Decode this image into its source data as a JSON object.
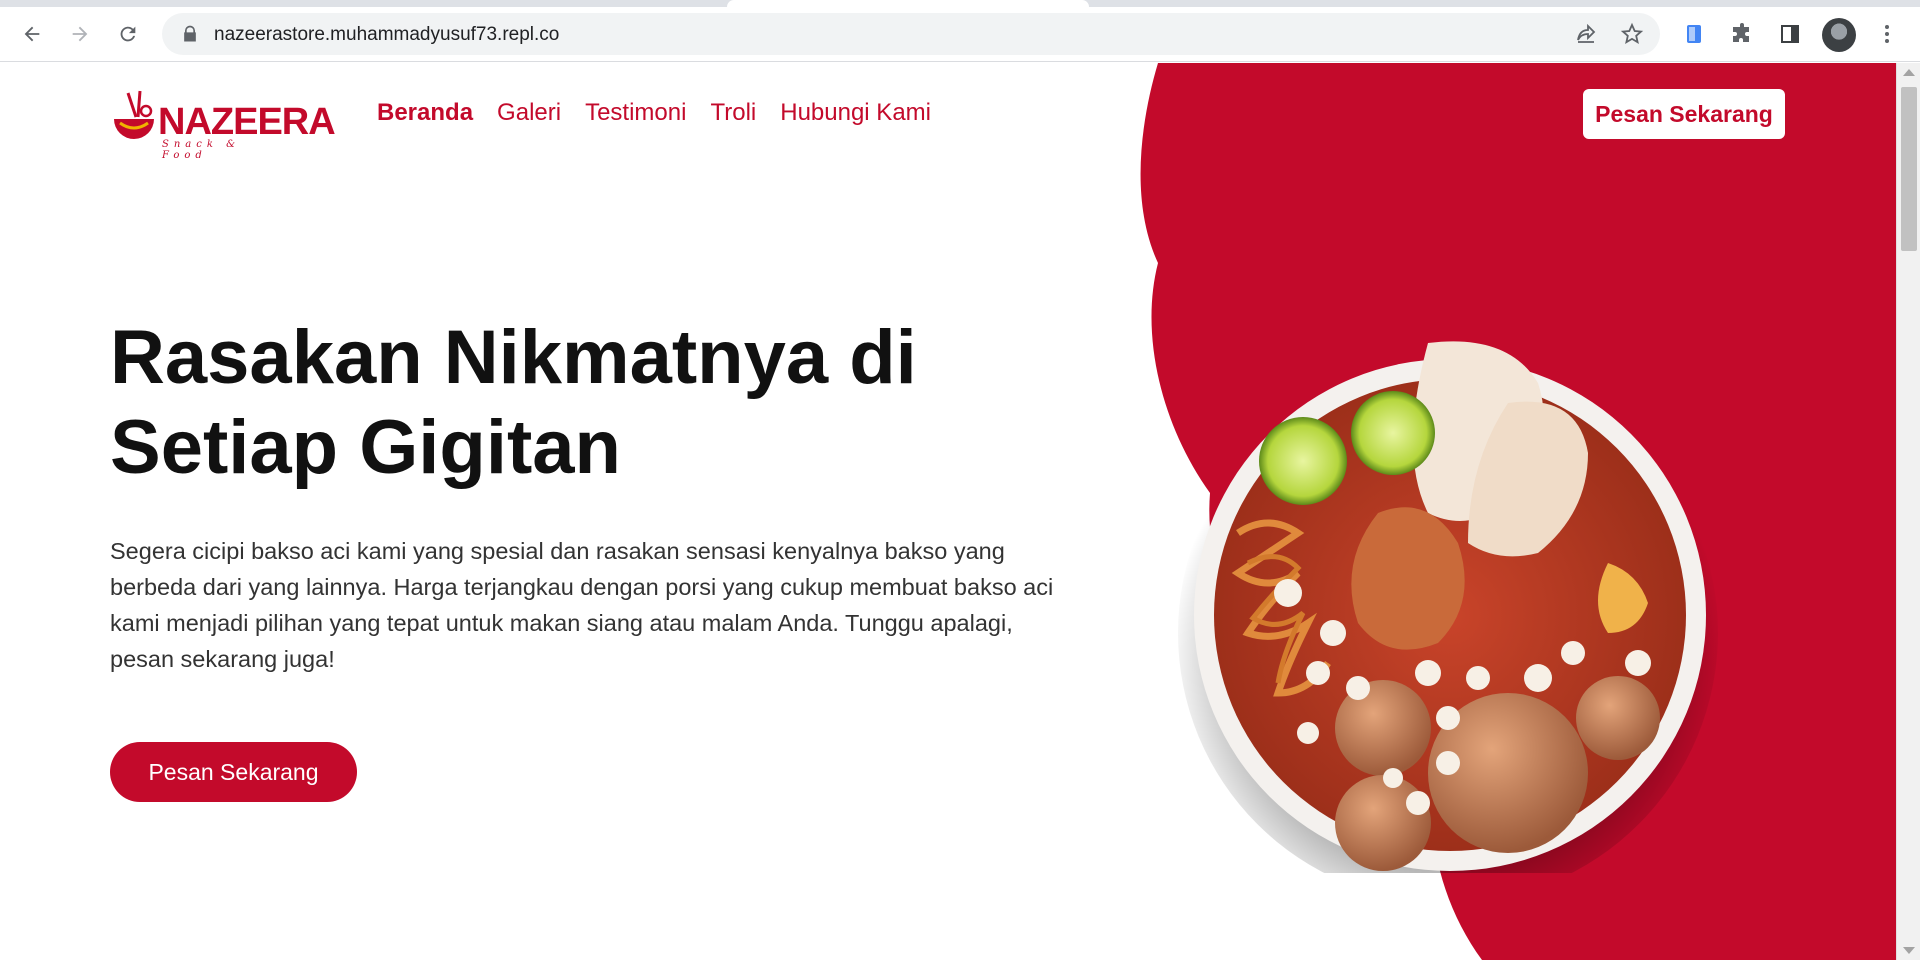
{
  "browser": {
    "url": "nazeerastore.muhammadyusuf73.repl.co",
    "icons": [
      "back-icon",
      "forward-icon",
      "reload-icon",
      "lock-icon",
      "share-icon",
      "star-icon",
      "extension-icon",
      "puzzle-icon",
      "sidepanel-icon",
      "profile-avatar",
      "menu-icon"
    ]
  },
  "brand": {
    "logo_word": "NAZEERA",
    "logo_tagline": "Snack & Food",
    "primary_color": "#c30a2b"
  },
  "nav": {
    "items": [
      {
        "label": "Beranda",
        "active": true
      },
      {
        "label": "Galeri",
        "active": false
      },
      {
        "label": "Testimoni",
        "active": false
      },
      {
        "label": "Troli",
        "active": false
      },
      {
        "label": "Hubungi Kami",
        "active": false
      }
    ],
    "cta_label": "Pesan Sekarang"
  },
  "hero": {
    "title_line1": "Rasakan Nikmatnya di",
    "title_line2": "Setiap Gigitan",
    "description": "Segera cicipi bakso aci kami yang spesial dan rasakan sensasi kenyalnya bakso yang berbeda dari yang lainnya. Harga terjangkau dengan porsi yang cukup membuat bakso aci kami menjadi pilihan yang tepat untuk makan siang atau malam Anda. Tunggu apalagi, pesan sekarang juga!",
    "cta_label": "Pesan Sekarang"
  }
}
